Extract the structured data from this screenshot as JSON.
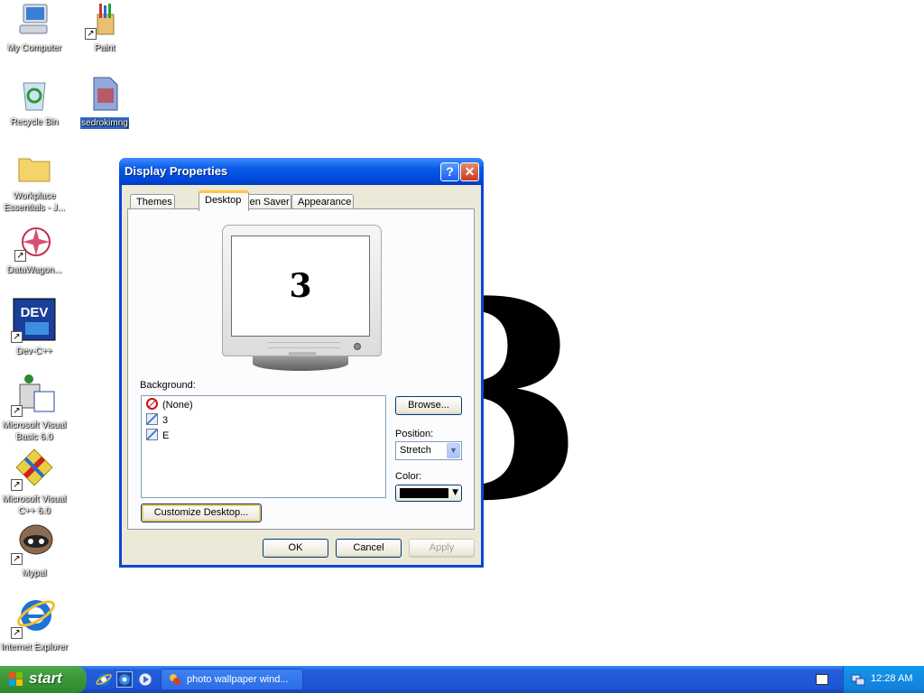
{
  "desktop": {
    "wallpaper_text": "3",
    "icons": [
      {
        "label": "My Computer"
      },
      {
        "label": "Paint"
      },
      {
        "label": "Recycle Bin"
      },
      {
        "label": "sedrokimng"
      },
      {
        "label": "Workplace Essentials - J..."
      },
      {
        "label": "DataWagon..."
      },
      {
        "label": "Dev-C++"
      },
      {
        "label": "Microsoft Visual Basic 6.0"
      },
      {
        "label": "Microsoft Visual C++ 6.0"
      },
      {
        "label": "Mypal"
      },
      {
        "label": "Internet Explorer"
      }
    ]
  },
  "dialog": {
    "title": "Display Properties",
    "help_glyph": "?",
    "close_glyph": "✕",
    "tabs": [
      {
        "label": "Themes"
      },
      {
        "label": "Desktop"
      },
      {
        "label": "Screen Saver"
      },
      {
        "label": "Appearance"
      }
    ],
    "preview_text": "3",
    "background_label": "Background:",
    "background_items": [
      {
        "label": "(None)"
      },
      {
        "label": "3"
      },
      {
        "label": "E"
      }
    ],
    "browse_label": "Browse...",
    "position_label": "Position:",
    "position_value": "Stretch",
    "color_label": "Color:",
    "color_value": "#000000",
    "customize_label": "Customize Desktop...",
    "ok_label": "OK",
    "cancel_label": "Cancel",
    "apply_label": "Apply"
  },
  "taskbar": {
    "start_label": "start",
    "task_label": "photo wallpaper wind...",
    "clock": "12:28 AM"
  }
}
